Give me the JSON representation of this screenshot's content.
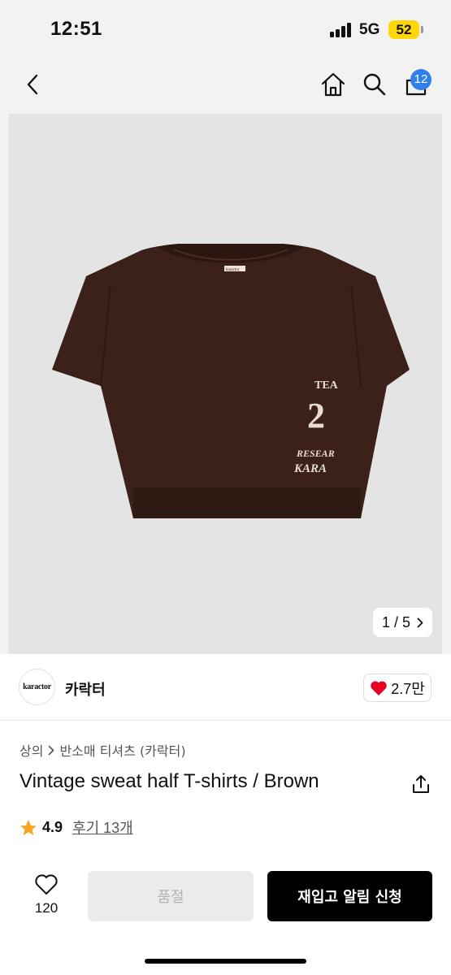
{
  "status_bar": {
    "time": "12:51",
    "network": "5G",
    "battery": "52"
  },
  "nav": {
    "cart_count": "12",
    "icons": [
      "back-icon",
      "home-icon",
      "search-icon",
      "cart-icon"
    ]
  },
  "gallery": {
    "current": "1",
    "separator": "/",
    "total": "5"
  },
  "product_print": {
    "line1": "TEA",
    "line2": "2",
    "line3": "RESEAR",
    "line4": "KARA",
    "neck_label": "karactor"
  },
  "brand": {
    "logo_text": "karactor",
    "name": "카락터",
    "likes": "2.7만"
  },
  "breadcrumb": {
    "category": "상의",
    "subcategory": "반소매 티셔츠 (카락터)"
  },
  "product": {
    "title": "Vintage sweat half T-shirts / Brown"
  },
  "rating": {
    "score": "4.9",
    "reviews": "후기 13개"
  },
  "actions": {
    "wish_count": "120",
    "soldout_label": "품절",
    "restock_label": "재입고 알림 신청"
  },
  "colors": {
    "shirt": "#3b2119",
    "heart": "#e60023",
    "star": "#f5a623",
    "badge": "#2f80ed",
    "battery": "#ffd60a"
  }
}
